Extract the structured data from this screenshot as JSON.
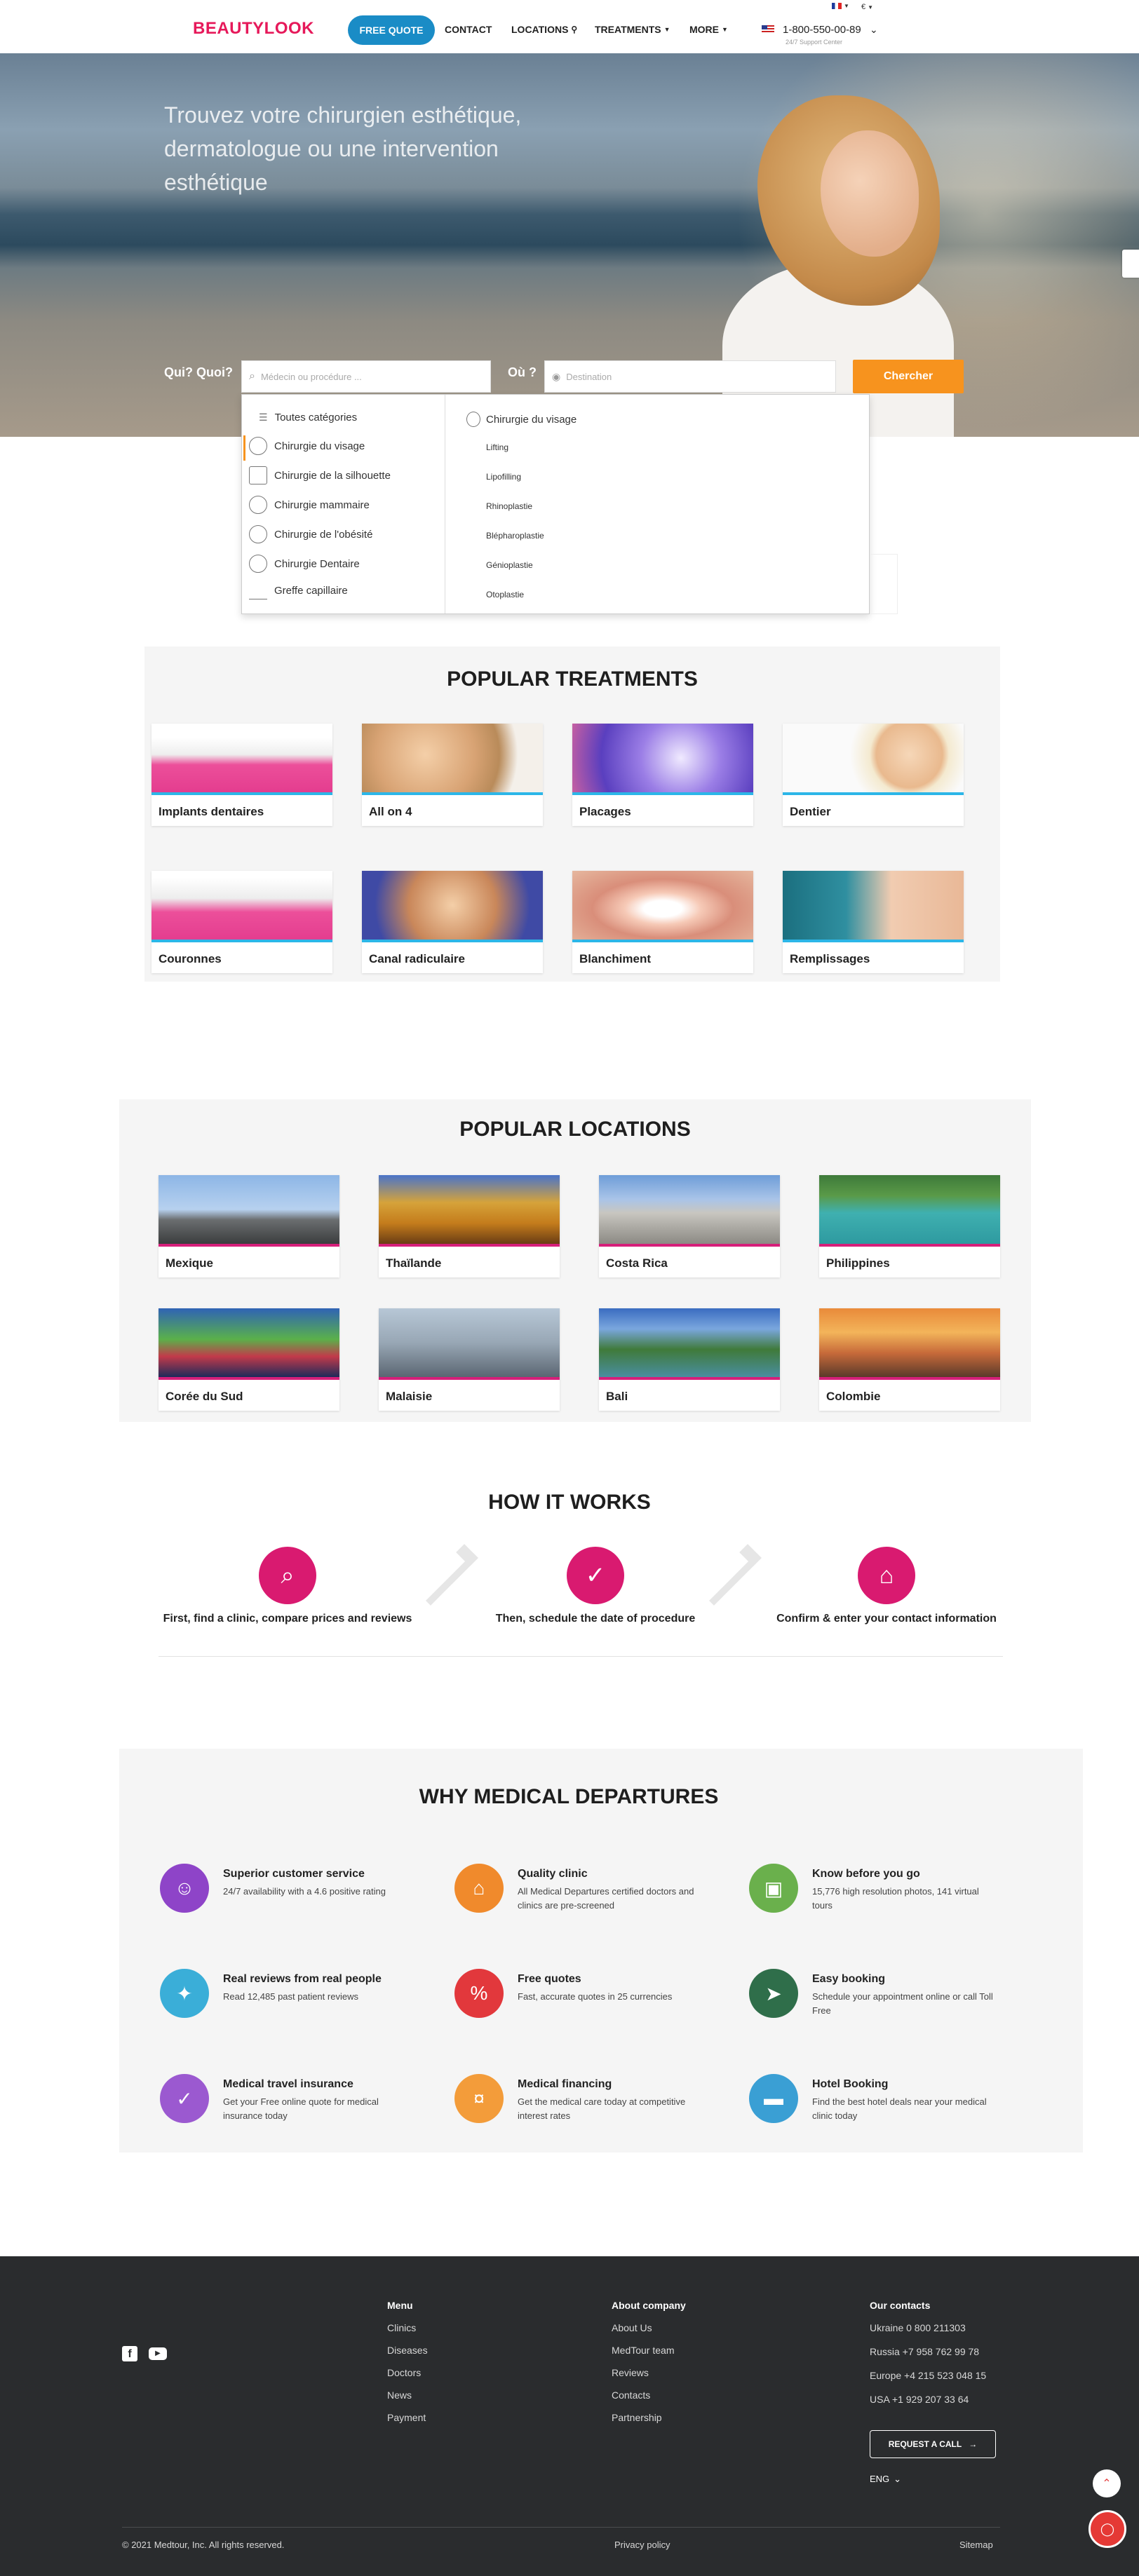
{
  "header": {
    "logo": "BEAUTYLOOK",
    "quote_btn": "FREE QUOTE",
    "nav": [
      "CONTACT",
      "LOCATIONS",
      "TREATMENTS",
      "MORE"
    ],
    "phone": "1-800-550-00-89",
    "support": "24/7 Support Center",
    "currency": "€"
  },
  "hero": {
    "title": "Trouvez votre chirurgien esthétique, dermatologue ou une intervention esthétique",
    "who_label": "Qui? Quoi?",
    "who_placeholder": "Médecin ou procédure ...",
    "where_label": "Où ?",
    "where_placeholder": "Destination",
    "search_btn": "Chercher"
  },
  "dropdown": {
    "categories": [
      "Toutes catégories",
      "Chirurgie du visage",
      "Chirurgie de la silhouette",
      "Chirurgie mammaire",
      "Chirurgie de l'obésité",
      "Chirurgie Dentaire",
      "Greffe capillaire"
    ],
    "sub_title": "Chirurgie du visage",
    "sub_items": [
      "Lifting",
      "Lipofilling",
      "Rhinoplastie",
      "Blépharoplastie",
      "Génioplastie",
      "Otoplastie"
    ]
  },
  "treatments": {
    "title": "POPULAR TREATMENTS",
    "items": [
      "Implants dentaires",
      "All on 4",
      "Placages",
      "Dentier",
      "Couronnes",
      "Canal radiculaire",
      "Blanchiment",
      "Remplissages"
    ]
  },
  "locations": {
    "title": "POPULAR LOCATIONS",
    "items": [
      "Mexique",
      "Thaïlande",
      "Costa Rica",
      "Philippines",
      "Corée du Sud",
      "Malaisie",
      "Bali",
      "Colombie"
    ]
  },
  "how": {
    "title": "HOW IT WORKS",
    "steps": [
      "First, find a clinic, compare prices and reviews",
      "Then, schedule the date of procedure",
      "Confirm & enter your contact information"
    ]
  },
  "why": {
    "title": "WHY MEDICAL DEPARTURES",
    "items": [
      {
        "title": "Superior customer service",
        "desc": "24/7 availability with a 4.6 positive rating",
        "color": "#8e44c8"
      },
      {
        "title": "Quality clinic",
        "desc": "All Medical Departures certified doctors and clinics are pre-screened",
        "color": "#f08a2c"
      },
      {
        "title": "Know before you go",
        "desc": "15,776 high resolution photos, 141 virtual tours",
        "color": "#6ab04c"
      },
      {
        "title": "Real reviews from real people",
        "desc": "Read 12,485 past patient reviews",
        "color": "#3aaed8"
      },
      {
        "title": "Free quotes",
        "desc": "Fast, accurate quotes in 25 currencies",
        "color": "#e2383c"
      },
      {
        "title": "Easy booking",
        "desc": "Schedule your appointment online or call Toll Free",
        "color": "#2f6e4a"
      },
      {
        "title": "Medical travel insurance",
        "desc": "Get your Free online quote for medical insurance today",
        "color": "#9b59d0"
      },
      {
        "title": "Medical financing",
        "desc": "Get the medical care today at competitive interest rates",
        "color": "#f39c3a"
      },
      {
        "title": "Hotel Booking",
        "desc": "Find the best hotel deals near your medical clinic today",
        "color": "#3a9fd4"
      }
    ]
  },
  "footer": {
    "menu_title": "Menu",
    "menu": [
      "Clinics",
      "Diseases",
      "Doctors",
      "News",
      "Payment"
    ],
    "about_title": "About company",
    "about": [
      "About Us",
      "MedTour team",
      "Reviews",
      "Contacts",
      "Partnership"
    ],
    "contacts_title": "Our contacts",
    "contacts": [
      "Ukraine  0 800 211303",
      "Russia  +7 958 762 99 78",
      "Europe  +4 215 523 048 15",
      "USA  +1 929 207 33 64"
    ],
    "request_btn": "REQUEST A CALL",
    "lang": "ENG",
    "copyright": "© 2021 Medtour, Inc. All rights reserved.",
    "privacy": "Privacy policy",
    "sitemap": "Sitemap"
  }
}
